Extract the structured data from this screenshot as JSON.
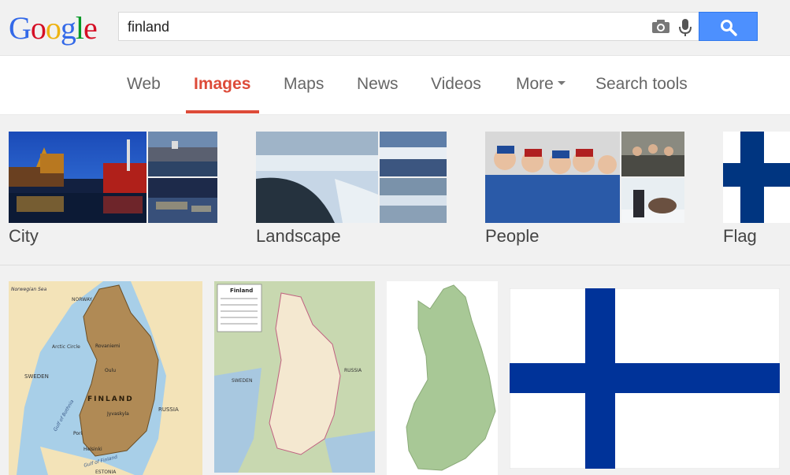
{
  "logo": {
    "letters": [
      "G",
      "o",
      "o",
      "g",
      "l",
      "e"
    ],
    "colors": [
      "#3369e8",
      "#d50f25",
      "#eeb211",
      "#3369e8",
      "#009925",
      "#d50f25"
    ]
  },
  "search": {
    "query": "finland",
    "camera_icon": "camera-icon",
    "mic_icon": "mic-icon",
    "button_icon": "search-icon"
  },
  "nav": {
    "web": "Web",
    "images": "Images",
    "maps": "Maps",
    "news": "News",
    "videos": "Videos",
    "more": "More",
    "search_tools": "Search tools"
  },
  "categories": [
    {
      "label": "City"
    },
    {
      "label": "Landscape"
    },
    {
      "label": "People"
    },
    {
      "label": "Flag"
    }
  ],
  "maps": {
    "map1": {
      "norwegian_sea": "Norwegian Sea",
      "norway": "NORWAY",
      "arctic_circle": "Arctic Circle",
      "rovaniemi": "Rovaniemi",
      "oulu": "Oulu",
      "sweden": "SWEDEN",
      "finland": "FINLAND",
      "gulf_bothnia": "Gulf of Bothnia",
      "jyvaskyla": "Jyvaskyla",
      "russia": "RUSSIA",
      "pori": "Pori",
      "helsinki": "Helsinki",
      "gulf_finland": "Gulf of Finland",
      "estonia": "ESTONIA"
    },
    "map2": {
      "legend_title": "Finland",
      "sweden": "SWEDEN",
      "russia": "RUSSIA"
    }
  },
  "colors": {
    "accent_red": "#dd4b39",
    "search_blue": "#4d90fe",
    "flag_blue": "#003399"
  }
}
